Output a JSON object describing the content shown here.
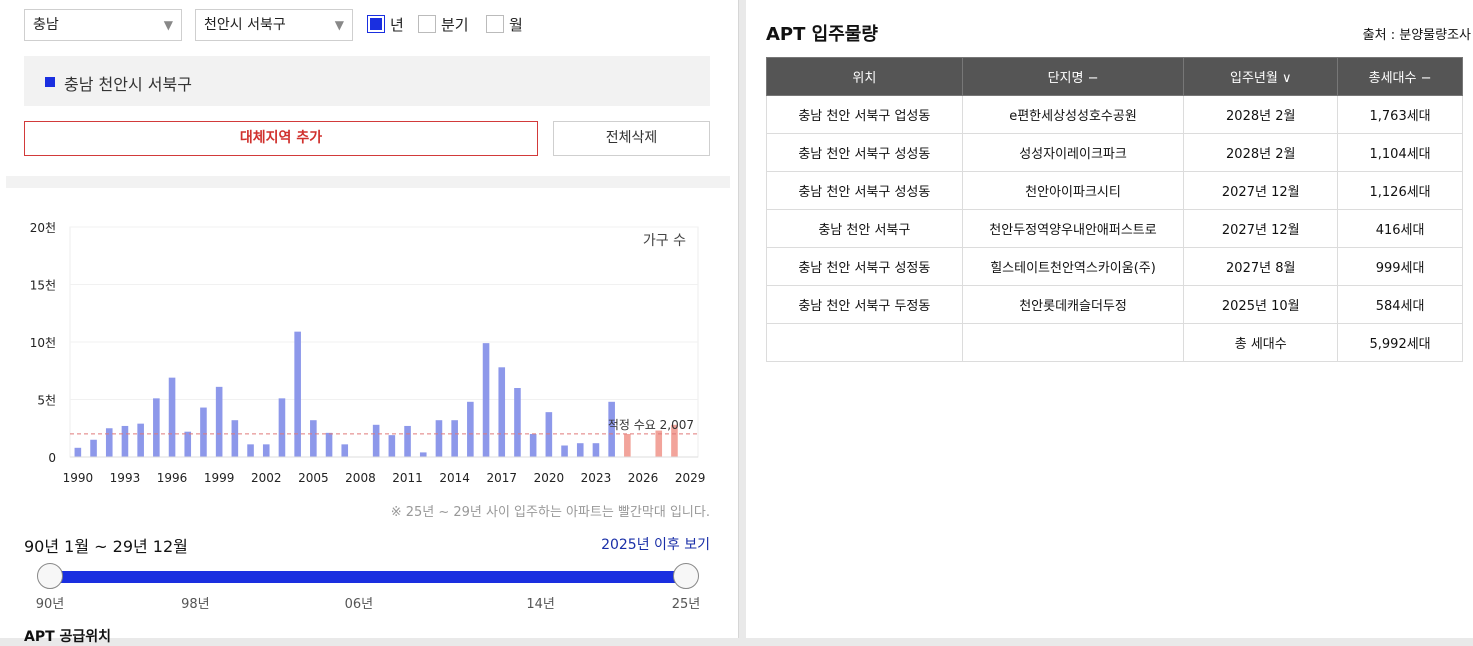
{
  "filters": {
    "province": "충남",
    "city": "천안시 서북구",
    "period_options": [
      {
        "label": "년",
        "checked": true
      },
      {
        "label": "분기",
        "checked": false
      },
      {
        "label": "월",
        "checked": false
      }
    ]
  },
  "region_chip": "충남 천안시 서북구",
  "buttons": {
    "add_region": "대체지역 추가",
    "delete_all": "전체삭제"
  },
  "chart_data": {
    "type": "bar",
    "legend": "가구 수",
    "y_ticks": [
      "0",
      "5천",
      "10천",
      "15천",
      "20천"
    ],
    "ylim": [
      0,
      20000
    ],
    "x_ticks": [
      "1990",
      "1993",
      "1996",
      "1999",
      "2002",
      "2005",
      "2008",
      "2011",
      "2014",
      "2017",
      "2020",
      "2023",
      "2026",
      "2029"
    ],
    "xlim": [
      1989.5,
      2029.5
    ],
    "years": [
      1990,
      1991,
      1992,
      1993,
      1994,
      1995,
      1996,
      1997,
      1998,
      1999,
      2000,
      2001,
      2002,
      2003,
      2004,
      2005,
      2006,
      2007,
      2008,
      2009,
      2010,
      2011,
      2012,
      2013,
      2014,
      2015,
      2016,
      2017,
      2018,
      2019,
      2020,
      2021,
      2022,
      2023,
      2024,
      2025,
      2026,
      2027,
      2028,
      2029
    ],
    "values": [
      800,
      1500,
      2500,
      2700,
      2900,
      5100,
      6900,
      2200,
      4300,
      6100,
      3200,
      1100,
      1100,
      5100,
      10900,
      3200,
      2100,
      1100,
      0,
      2800,
      1900,
      2700,
      400,
      3200,
      3200,
      4800,
      9900,
      7800,
      6000,
      2000,
      3900,
      1000,
      1200,
      1200,
      4800,
      2000,
      0,
      2300,
      2800,
      0
    ],
    "highlight_from_year": 2025,
    "colors": {
      "normal": "#8d98ea",
      "future": "#f2a49b",
      "reference": "#e07a7a"
    },
    "reference_line": {
      "label": "적정 수요",
      "value": 2007,
      "value_text": "2,007"
    }
  },
  "chart_note": "※ 25년 ~ 29년 사이 입주하는 아파트는 빨간막대 입니다.",
  "period_label": "90년 1월 ~ 29년 12월",
  "after_link": "2025년 이후 보기",
  "slider": {
    "range_from": 0,
    "range_to": 1,
    "labels": [
      {
        "text": "90년",
        "pos": 0
      },
      {
        "text": "98년",
        "pos": 0.2286
      },
      {
        "text": "06년",
        "pos": 0.4857
      },
      {
        "text": "14년",
        "pos": 0.7714
      },
      {
        "text": "25년",
        "pos": 1
      }
    ]
  },
  "bottom_heading": "APT 공급위치",
  "apt_panel": {
    "title": "APT 입주물량",
    "source": "출처 : 분양물량조사",
    "headers": [
      "위치",
      "단지명 −",
      "입주년월 ∨",
      "총세대수 −"
    ],
    "rows": [
      [
        "충남 천안 서북구 업성동",
        "e편한세상성성호수공원",
        "2028년 2월",
        "1,763세대"
      ],
      [
        "충남 천안 서북구 성성동",
        "성성자이레이크파크",
        "2028년 2월",
        "1,104세대"
      ],
      [
        "충남 천안 서북구 성성동",
        "천안아이파크시티",
        "2027년 12월",
        "1,126세대"
      ],
      [
        "충남 천안 서북구",
        "천안두정역양우내안애퍼스트로",
        "2027년 12월",
        "416세대"
      ],
      [
        "충남 천안 서북구 성정동",
        "힐스테이트천안역스카이움(주)",
        "2027년 8월",
        "999세대"
      ],
      [
        "충남 천안 서북구 두정동",
        "천안롯데캐슬더두정",
        "2025년 10월",
        "584세대"
      ],
      [
        "",
        "",
        "총 세대수",
        "5,992세대"
      ]
    ]
  }
}
